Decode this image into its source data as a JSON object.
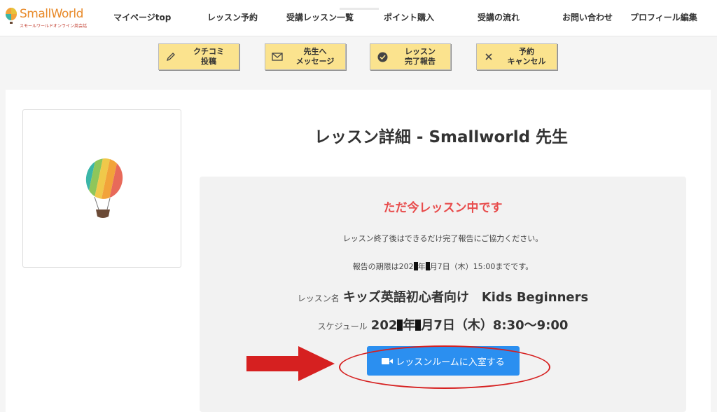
{
  "logo": {
    "name": "SmallWorld",
    "tagline": "スモールワールドオンライン英会話"
  },
  "nav": [
    {
      "label": "マイページtop"
    },
    {
      "label": "レッスン予約"
    },
    {
      "label": "受講レッスン一覧"
    },
    {
      "label": "ポイント購入"
    },
    {
      "label": "受講の流れ"
    },
    {
      "label": "お問い合わせ"
    },
    {
      "label": "プロフィール編集"
    }
  ],
  "actions": [
    {
      "label": "クチコミ\n投稿",
      "icon": "pencil-icon"
    },
    {
      "label": "先生へ\nメッセージ",
      "icon": "envelope-icon"
    },
    {
      "label": "レッスン\n完了報告",
      "icon": "check-circle-icon"
    },
    {
      "label": "予約\nキャンセル",
      "icon": "x-icon"
    }
  ],
  "lesson": {
    "title": "レッスン詳細 - Smallworld 先生",
    "status": "ただ今レッスン中です",
    "note": "レッスン終了後はできるだけ完了報告にご協力ください。",
    "deadline_prefix": "報告の期限は202",
    "deadline_mid": "年",
    "deadline_suffix": "月7日（木）15:00までです。",
    "name_label": "レッスン名",
    "name_value": "キッズ英語初心者向け　Kids Beginners",
    "schedule_label": "スケジュール",
    "schedule_prefix": "202",
    "schedule_mid": "年",
    "schedule_suffix": "月7日（木）8:30〜9:00",
    "enter_button": "レッスンルームに入室する"
  },
  "colors": {
    "accent_yellow": "#fbe38e",
    "status_red": "#e84c4c",
    "button_blue": "#2b8ff0",
    "annotation_red": "#d62020"
  }
}
